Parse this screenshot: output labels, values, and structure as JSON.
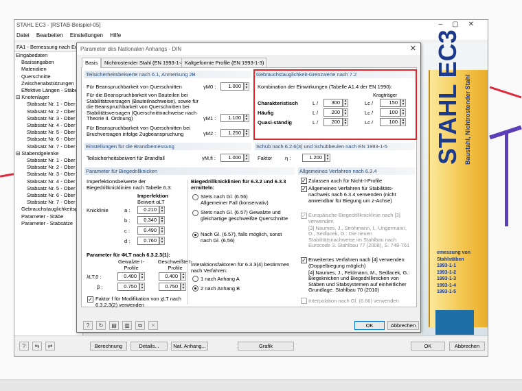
{
  "app": {
    "title": "STAHL EC3 - [RSTAB-Beispiel-05]",
    "menu": [
      "Datei",
      "Bearbeiten",
      "Einstellungen",
      "Hilfe"
    ],
    "nav_header": "FA1 - Bemessung nach Eurocode 3",
    "tree": [
      {
        "label": "Eingabedaten",
        "level": 0
      },
      {
        "label": "Basisangaben",
        "level": 1
      },
      {
        "label": "Materialien",
        "level": 1
      },
      {
        "label": "Querschnitte",
        "level": 1
      },
      {
        "label": "Zwischenabstützungen",
        "level": 1
      },
      {
        "label": "Effektive Längen - Stäbe",
        "level": 1
      },
      {
        "label": "Knotenlager",
        "level": 0,
        "collapse": "⊟"
      },
      {
        "label": "Stabsatz Nr. 1 - Ober",
        "level": 2
      },
      {
        "label": "Stabsatz Nr. 2 - Ober",
        "level": 2
      },
      {
        "label": "Stabsatz Nr. 3 - Ober",
        "level": 2
      },
      {
        "label": "Stabsatz Nr. 4 - Ober",
        "level": 2
      },
      {
        "label": "Stabsatz Nr. 5 - Ober",
        "level": 2
      },
      {
        "label": "Stabsatz Nr. 6 - Ober",
        "level": 2
      },
      {
        "label": "Stabsatz Nr. 7 - Ober",
        "level": 2
      },
      {
        "label": "Stabendgelenke",
        "level": 0,
        "collapse": "⊟"
      },
      {
        "label": "Stabsatz Nr. 1 - Ober",
        "level": 2
      },
      {
        "label": "Stabsatz Nr. 2 - Ober",
        "level": 2
      },
      {
        "label": "Stabsatz Nr. 3 - Ober",
        "level": 2
      },
      {
        "label": "Stabsatz Nr. 4 - Ober",
        "level": 2
      },
      {
        "label": "Stabsatz Nr. 5 - Ober",
        "level": 2
      },
      {
        "label": "Stabsatz Nr. 6 - Ober",
        "level": 2
      },
      {
        "label": "Stabsatz Nr. 7 - Ober",
        "level": 2
      },
      {
        "label": "Gebrauchstauglichkeitspa",
        "level": 1
      },
      {
        "label": "Parameter - Stäbe",
        "level": 1
      },
      {
        "label": "Parameter - Stabsätze",
        "level": 1
      }
    ],
    "bottom": {
      "berechnung": "Berechnung",
      "details": "Details...",
      "nat_anhang": "Nat. Anhang...",
      "grafik": "Grafik",
      "ok": "OK",
      "abbrechen": "Abbrechen"
    },
    "book": {
      "title": "STAHL EC3",
      "subtitle": "Baustahl, Nichtrostender Stahl",
      "list": [
        "emessung von Stahlstäben",
        "1993-1-1",
        "1993-1-2",
        "1993-1-3",
        "1993-1-4",
        "1993-1-5"
      ]
    }
  },
  "dialog": {
    "title": "Parameter des Nationalen Anhangs - DIN",
    "tabs": [
      "Basis",
      "Nichtrostender Stahl (EN 1993-1-4)",
      "Kaltgeformte Profile (EN 1993-1-3)"
    ],
    "teilsicherheit": {
      "header": "Teilsicherheitsbeiwerte nach 6.1, Anmerkung 2B",
      "r1_label": "Für Beanspruchbarkeit von Querschnitten",
      "r1_sym": "γM0 :",
      "r1_val": "1.000",
      "r2_label": "Für die Beanspruchbarkeit von Bauteilen bei Stabilitätsversagen (Bauteilnachweise), sowie für die Beanspruchbarkeit von Querschnitten bei Stabilitätsversagen (Querschnittnachweise nach Theorie II. Ordnung)",
      "r2_sym": "γM1 :",
      "r2_val": "1.100",
      "r3_label": "Für Beanspruchbarkeit von Querschnitten bei Bruchversagen infolge Zugbeanspruchung",
      "r3_sym": "γM2 :",
      "r3_val": "1.250"
    },
    "gebrauch": {
      "header": "Gebrauchstauglichkeit-Grenzwerte nach 7.2",
      "kombination": "Kombination der Einwirkungen (Tabelle A1.4 der EN 1990):",
      "kragtraeger": "Kragträger",
      "rows": [
        {
          "label": "Charakteristisch",
          "l": "300",
          "lc": "150"
        },
        {
          "label": "Häufig",
          "l": "200",
          "lc": "100"
        },
        {
          "label": "Quasi-ständig",
          "l": "200",
          "lc": "100"
        }
      ],
      "l_sym": "L /",
      "lc_sym": "Lc /"
    },
    "brand": {
      "header": "Einstellungen für die Brandbemessung",
      "label": "Teilsicherheitsbeiwert für Brandfall",
      "sym": "γM,fi :",
      "val": "1.000"
    },
    "schub": {
      "header": "Schub nach 6.2.6(3) und Schubbeulen nach EN 1993-1-5",
      "label": "Faktor",
      "sym": "η :",
      "val": "1.200"
    },
    "biegedrill": {
      "header": "Parameter für Biegedrillknicken",
      "imperf_label": "Imperfektionsbeiwerte der Biegedrillknicklinien nach Tabelle 6.3:",
      "imperf_head1": "Imperfektion",
      "imperf_head2": "Beiwert αLT",
      "knicklinie": "Knicklinie",
      "curves": [
        {
          "k": "a :",
          "v": "0.210"
        },
        {
          "k": "b :",
          "v": "0.340"
        },
        {
          "k": "c :",
          "v": "0.490"
        },
        {
          "k": "d :",
          "v": "0.760"
        }
      ],
      "phi_label": "Parameter für ΦLT nach 6.3.2.3(1):",
      "col1": "Gewalzte I-Profile",
      "col2": "Geschweißte I-Profile",
      "lambda_sym": "λLT,0 :",
      "lambda1": "0.400",
      "lambda2": "0.400",
      "beta_sym": "β :",
      "beta1": "0.750",
      "beta2": "0.750",
      "faktor_label": "Faktor f für Modifikation von χLT nach 6.3.2.3(2) verwenden",
      "kurven_label": "Biegedrillknicklinien für 6.3.2 und 6.3.3 ermitteln:",
      "opt1": "Stets nach Gl. (6.56) Allgemeiner Fall (konservativ)",
      "opt2": "Stets nach Gl. (6.57) Gewalzte und gleichartige geschweißte Querschnitte",
      "opt3": "Nach Gl. (6.57), falls möglich, sonst nach Gl. (6.56)",
      "interakt_label": "Interaktionsfaktoren für 6.3.3(4) bestimmen nach Verfahren:",
      "int1": "1 nach Anhang A",
      "int2": "2 nach Anhang B"
    },
    "allgemein": {
      "header": "Allgemeines Verfahren nach 6.3.4",
      "c1": "Zulassen auch für Nicht-I-Profile",
      "c2": "Allgemeines Verfahren für Stabilitäts-nachweis nach 6.3.4 verwenden (nicht anwendbar für Biegung um z-Achse)",
      "c3": "Europäische Biegedrillknicklinie nach [3] verwenden",
      "ref3": "[3] Naumes, J., Strohmann, I., Ungermann, D., Sedlacek, G.: Die neuen Stabilitätsnachweise im Stahlbau nach Eurocode 3. Stahlbau 77 (2008), S. 748-761",
      "c4": "Erweitertes Verfahren nach [4] verwenden (Doppelbiegung möglich)",
      "ref4": "[4] Naumes, J., Feldmann, M., Sedlacek, G.: Biegeknicken und Biegedrillknicken von Stäben und Stabsystemen auf einheitlicher Grundlage. Stahlbau 70 (2010)",
      "c5": "Interpolation nach Gl. (6.66) verwenden"
    },
    "footer": {
      "ok": "OK",
      "abbrechen": "Abbrechen"
    }
  },
  "colors": {
    "accent": "#0078d7",
    "highlight": "#d62828",
    "header_text": "#2b4f7c",
    "book_blue": "#1b3a8c"
  }
}
